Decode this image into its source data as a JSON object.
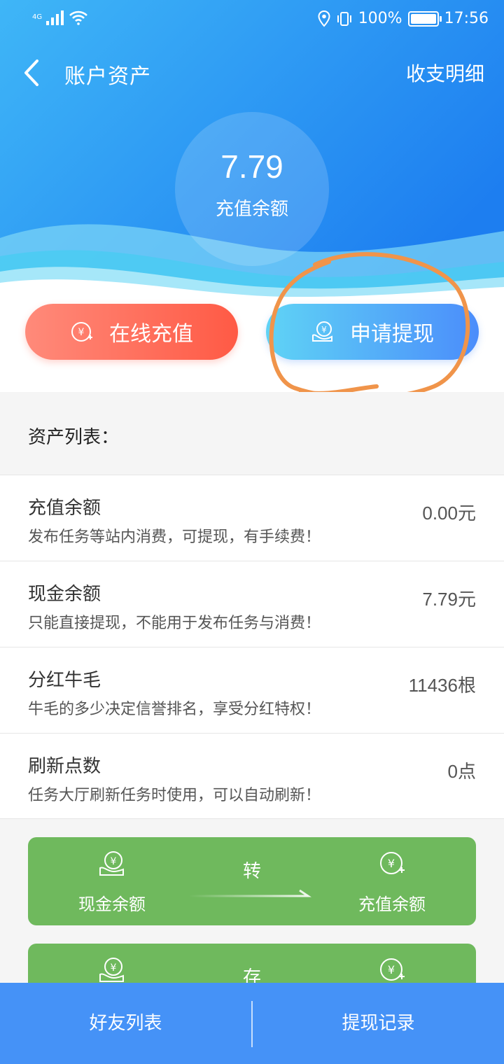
{
  "status_bar": {
    "network_type": "4G",
    "battery": "100%",
    "battery_level": 1.0,
    "time": "17:56"
  },
  "nav": {
    "title": "账户资产",
    "right_link": "收支明细"
  },
  "balance": {
    "value": "7.79",
    "label": "充值余额"
  },
  "actions": {
    "recharge_label": "在线充值",
    "withdraw_label": "申请提现"
  },
  "asset_section_title": "资产列表：",
  "assets": [
    {
      "name": "充值余额",
      "desc": "发布任务等站内消费，可提现，有手续费！",
      "value": "0.00",
      "unit": "元"
    },
    {
      "name": "现金余额",
      "desc": "只能直接提现，不能用于发布任务与消费！",
      "value": "7.79",
      "unit": "元"
    },
    {
      "name": "分红牛毛",
      "desc": "牛毛的多少决定信誉排名，享受分红特权！",
      "value": "11436",
      "unit": "根"
    },
    {
      "name": "刷新点数",
      "desc": "任务大厅刷新任务时使用，可以自动刷新！",
      "value": "0",
      "unit": "点"
    }
  ],
  "transfers": [
    {
      "from": "现金余额",
      "action": "转",
      "to": "充值余额"
    },
    {
      "from": "",
      "action": "存",
      "to": ""
    }
  ],
  "bottom_bar": {
    "left": "好友列表",
    "right": "提现记录"
  },
  "colors": {
    "header_blue": "#2f8ff5",
    "recharge_red": "#ff5a45",
    "withdraw_blue": "#4b8dfb",
    "card_green": "#6fb95d",
    "bottom_blue": "#4592f7",
    "annotation_orange": "#f0944a"
  },
  "icons": {
    "back": "chevron-left-icon",
    "recharge": "yuan-plus-icon",
    "withdraw": "yuan-hand-icon"
  }
}
